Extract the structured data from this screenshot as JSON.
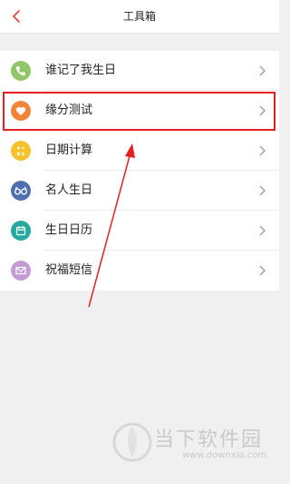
{
  "header": {
    "title": "工具箱"
  },
  "items": [
    {
      "label": "谁记了我生日",
      "icon": "phone-icon",
      "color": "#93c66a"
    },
    {
      "label": "缘分测试",
      "icon": "heart-tag-icon",
      "color": "#f0853a"
    },
    {
      "label": "日期计算",
      "icon": "calculator-icon",
      "color": "#f5c22d"
    },
    {
      "label": "名人生日",
      "icon": "glasses-icon",
      "color": "#4f6fb0"
    },
    {
      "label": "生日日历",
      "icon": "calendar-icon",
      "color": "#27a9a0"
    },
    {
      "label": "祝福短信",
      "icon": "envelope-icon",
      "color": "#c59bd4"
    }
  ],
  "watermark": {
    "text": "当下软件园",
    "url": "www.downxia.com"
  },
  "colors": {
    "annotation": "#e32020",
    "chevron": "#9a9a9a",
    "back": "#e83d3d"
  }
}
